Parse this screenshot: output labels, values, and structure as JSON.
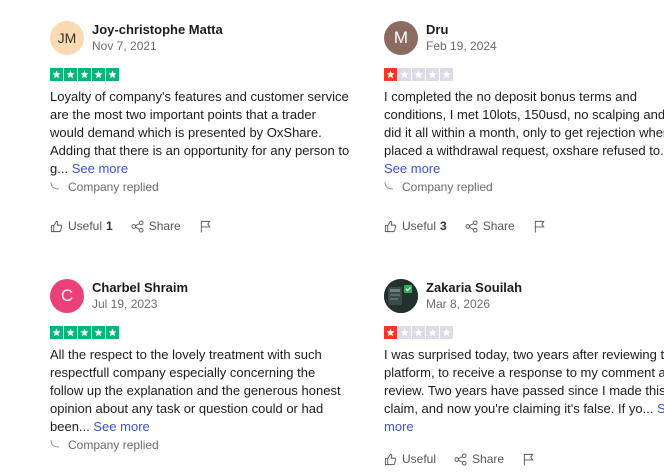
{
  "colors": {
    "star_green": "#00b67a",
    "star_red": "#ff3722",
    "star_empty": "#dcdce6",
    "link": "#3c57bc"
  },
  "reviews": [
    {
      "initials": "JM",
      "avatar_bg": "#fbd9b3",
      "avatar_color": "#333333",
      "name": "Joy-christophe Matta",
      "date": "Nov 7, 2021",
      "rating": 5,
      "text": "Loyalty of company's features and customer service are the most two important points that a trader would demand which is presented by OxShare. Adding that there is an opportunity for any person to g...",
      "see_more": "See more",
      "replied": "Company replied",
      "useful_label": "Useful",
      "useful_count": "1",
      "share_label": "Share"
    },
    {
      "initials": "M",
      "avatar_bg": "#8c6c62",
      "avatar_color": "#ffffff",
      "name": "Dru",
      "date": "Feb 19, 2024",
      "rating": 1,
      "text": "I completed the no deposit bonus terms and conditions, I met 10lots, 150usd, no scalping and did it all within a month, only to get rejection when I placed a withdrawal request, oxshare refused to...",
      "see_more": "See more",
      "replied": "Company replied",
      "useful_label": "Useful",
      "useful_count": "3",
      "share_label": "Share"
    },
    {
      "initials": "C",
      "avatar_bg": "#ec407a",
      "avatar_color": "#ffffff",
      "name": "Charbel Shraim",
      "date": "Jul 19, 2023",
      "rating": 5,
      "text": "All the respect to the lovely treatment with such respectfull company especially concerning the follow up the explanation and the generous honest opinion about any task or question could or had been...",
      "see_more": "See more",
      "replied": "Company replied",
      "useful_label": "Useful",
      "useful_count": "",
      "share_label": "Share"
    },
    {
      "initials": "",
      "avatar_bg": "#1f2d2a",
      "avatar_color": "#ffffff",
      "name": "Zakaria Souilah",
      "date": "Mar 8, 2026",
      "rating": 1,
      "text": "I was surprised today, two years after reviewing this platform, to receive a response to my comment and review. Two years have passed since I made this claim, and now you're claiming it's false. If yo...",
      "see_more": "See more",
      "replied": "",
      "useful_label": "Useful",
      "useful_count": "",
      "share_label": "Share"
    }
  ]
}
